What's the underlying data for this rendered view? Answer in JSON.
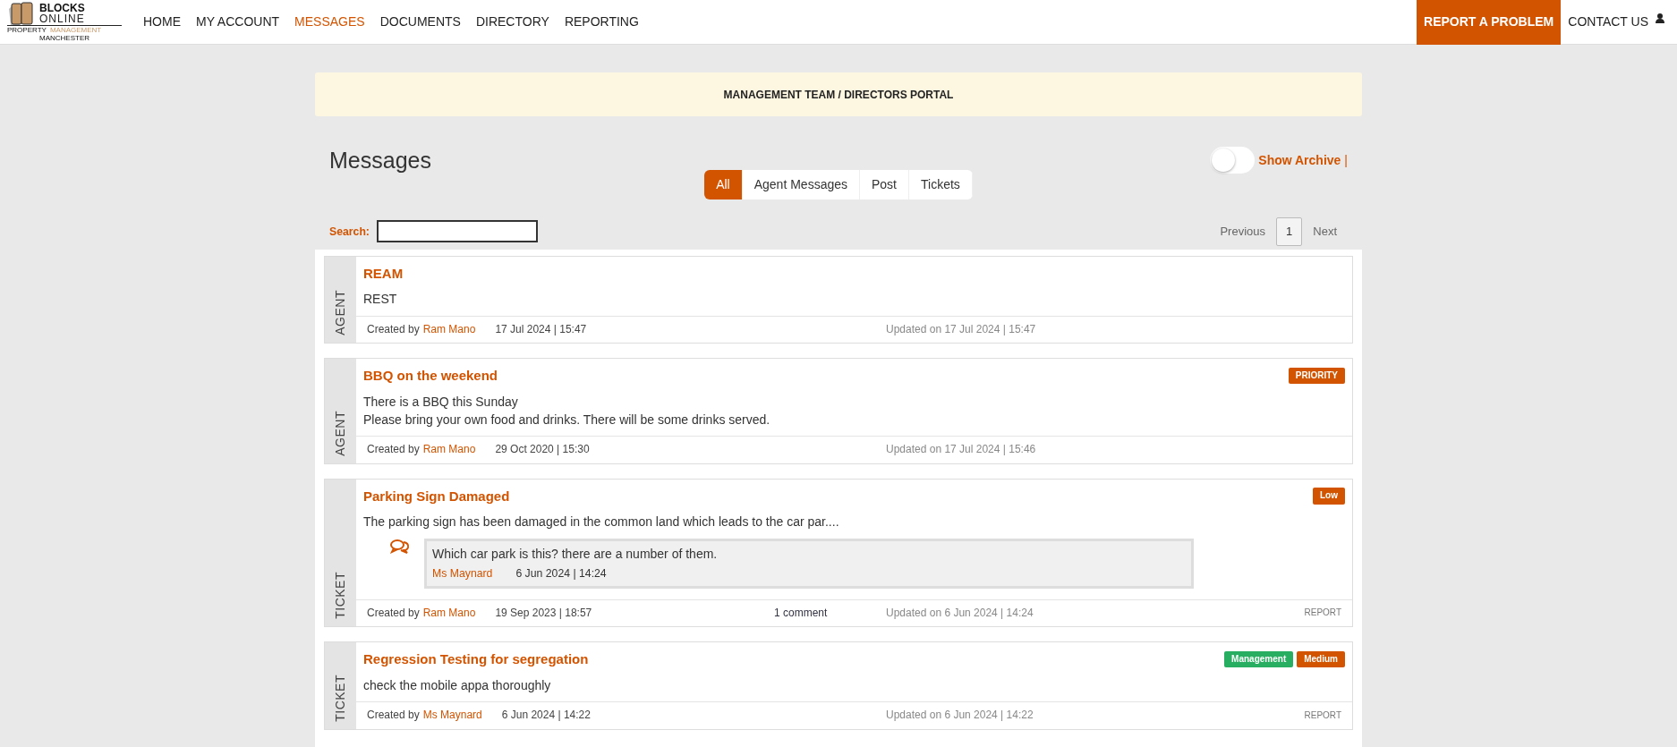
{
  "logo": {
    "line1": "BLOCKS",
    "line2": "ONLINE",
    "tagline": [
      "PROPERTY",
      "MANAGEMENT"
    ],
    "city": "MANCHESTER"
  },
  "nav": [
    {
      "label": "HOME",
      "selected": false
    },
    {
      "label": "MY ACCOUNT",
      "selected": false
    },
    {
      "label": "MESSAGES",
      "selected": true
    },
    {
      "label": "DOCUMENTS",
      "selected": false
    },
    {
      "label": "DIRECTORY",
      "selected": false
    },
    {
      "label": "REPORTING",
      "selected": false
    }
  ],
  "report_button": "REPORT A PROBLEM",
  "contact_link": "CONTACT US",
  "banner": "MANAGEMENT TEAM / DIRECTORS PORTAL",
  "heading": "Messages",
  "archive": {
    "label": "Show Archive",
    "separator": "|",
    "on": false
  },
  "filters": [
    {
      "label": "All",
      "selected": true
    },
    {
      "label": "Agent Messages",
      "selected": false
    },
    {
      "label": "Post",
      "selected": false
    },
    {
      "label": "Tickets",
      "selected": false
    }
  ],
  "search": {
    "label": "Search:"
  },
  "pagination": {
    "previous": "Previous",
    "pages": [
      {
        "label": "1",
        "selected": true
      }
    ],
    "next": "Next"
  },
  "messages": [
    {
      "kind": "AGENT",
      "title": "REAM",
      "body": [
        "REST"
      ],
      "created_label": "Created by",
      "author": "Ram Mano",
      "created": "17 Jul 2024 | 15:47",
      "updated": "Updated on 17 Jul 2024 | 15:47"
    },
    {
      "kind": "AGENT",
      "title": "BBQ on the weekend",
      "tags": [
        {
          "label": "PRIORITY",
          "color": "#d35400"
        }
      ],
      "body": [
        "There is a BBQ this Sunday",
        "Please bring your own food and drinks. There will be some drinks served."
      ],
      "created_label": "Created by",
      "author": "Ram Mano",
      "created": "29 Oct 2020 | 15:30",
      "updated": "Updated on 17 Jul 2024 | 15:46"
    },
    {
      "kind": "TICKET",
      "title": "Parking Sign Damaged",
      "tags": [
        {
          "label": "Low",
          "color": "#d35400"
        }
      ],
      "body": [
        "The parking sign has been damaged in the common land which leads to the car par...."
      ],
      "comment": {
        "text": "Which car park is this? there are a number of them.",
        "author": "Ms Maynard",
        "date": "6 Jun 2024 | 14:24"
      },
      "created_label": "Created by",
      "author": "Ram Mano",
      "created": "19 Sep 2023 | 18:57",
      "comments": "1 comment",
      "updated": "Updated on 6 Jun 2024 | 14:24",
      "report": "REPORT"
    },
    {
      "kind": "TICKET",
      "title": "Regression Testing for segregation",
      "tags": [
        {
          "label": "Management",
          "color": "#27ae60"
        },
        {
          "label": "Medium",
          "color": "#d35400"
        }
      ],
      "body": [
        "check the mobile appa thoroughly"
      ],
      "created_label": "Created by",
      "author": "Ms Maynard",
      "created": "6 Jun 2024 | 14:22",
      "updated": "Updated on 6 Jun 2024 | 14:22",
      "report": "REPORT"
    }
  ]
}
